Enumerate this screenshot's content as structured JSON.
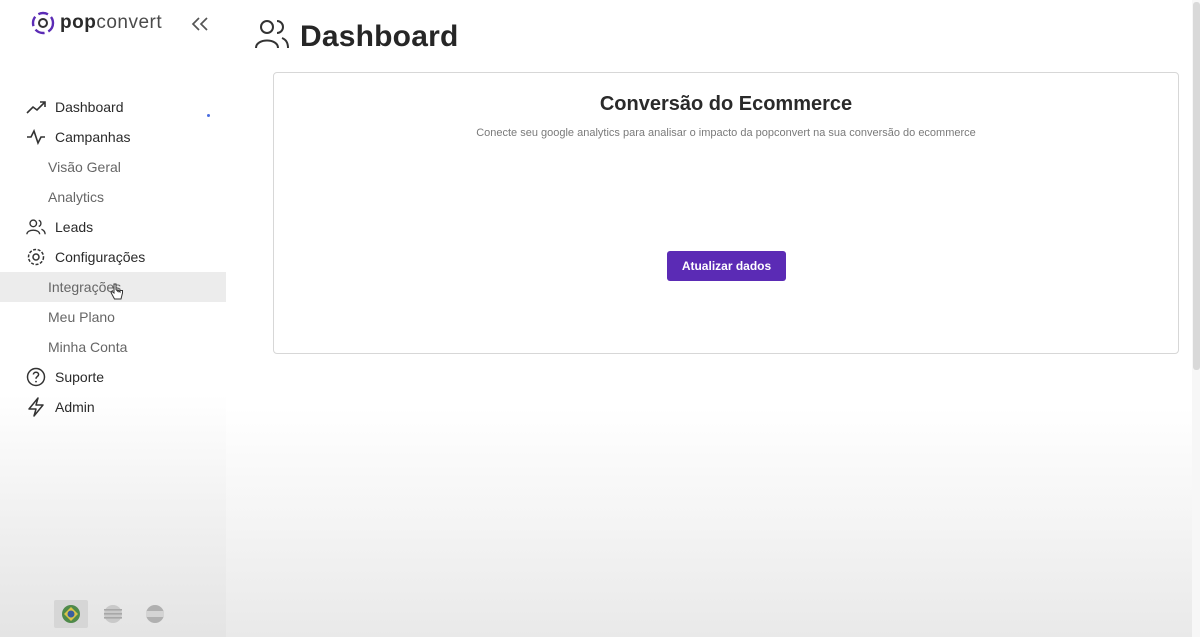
{
  "logo": {
    "bold": "pop",
    "light": "convert"
  },
  "sidebar": {
    "items": [
      {
        "label": "Dashboard",
        "icon": "trending-up-icon"
      },
      {
        "label": "Campanhas",
        "icon": "activity-icon"
      },
      {
        "label": "Visão Geral"
      },
      {
        "label": "Analytics"
      },
      {
        "label": "Leads",
        "icon": "users-icon"
      },
      {
        "label": "Configurações",
        "icon": "gear-icon"
      },
      {
        "label": "Integrações",
        "active": true
      },
      {
        "label": "Meu Plano"
      },
      {
        "label": "Minha Conta"
      },
      {
        "label": "Suporte",
        "icon": "help-circle-icon"
      },
      {
        "label": "Admin",
        "icon": "lightning-icon"
      }
    ],
    "languages": [
      "brazil-flag-icon",
      "usa-flag-icon",
      "spain-flag-icon"
    ]
  },
  "page": {
    "title": "Dashboard",
    "icon": "users-icon"
  },
  "card": {
    "title": "Conversão do Ecommerce",
    "subtitle": "Conecte seu google analytics para analisar o impacto da popconvert na sua conversão do ecommerce",
    "button_label": "Atualizar dados"
  },
  "colors": {
    "accent": "#5b2bb5",
    "logo_ring": "#5b2bb5"
  }
}
